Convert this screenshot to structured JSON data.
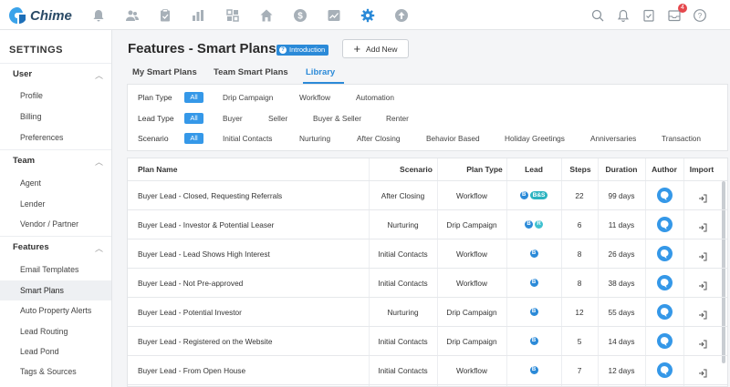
{
  "app": {
    "name": "Chime"
  },
  "topnav": {
    "left_icons": [
      "bell-icon",
      "people-icon",
      "clipboard-icon",
      "bar-chart-icon",
      "dashboard-icon",
      "home-icon",
      "dollar-icon",
      "trend-icon",
      "settings-icon",
      "upload-icon"
    ],
    "right_icons": [
      "search-icon",
      "notification-icon",
      "task-icon",
      "inbox-icon",
      "help-icon"
    ],
    "inbox_badge": "4",
    "accent": "#2b8ad8"
  },
  "sidebar": {
    "title": "SETTINGS",
    "sections": [
      {
        "label": "User",
        "items": [
          "Profile",
          "Billing",
          "Preferences"
        ]
      },
      {
        "label": "Team",
        "items": [
          "Agent",
          "Lender",
          "Vendor / Partner"
        ]
      },
      {
        "label": "Features",
        "items": [
          "Email Templates",
          "Smart Plans",
          "Auto Property Alerts",
          "Lead Routing",
          "Lead Pond",
          "Tags & Sources"
        ]
      }
    ],
    "active_item": "Smart Plans"
  },
  "page": {
    "title": "Features - Smart Plans",
    "intro_label": "Introduction",
    "add_new_label": "Add New",
    "tabs": [
      "My Smart Plans",
      "Team Smart Plans",
      "Library"
    ],
    "active_tab": "Library"
  },
  "filters": {
    "all_label": "All",
    "plan_type": {
      "label": "Plan Type",
      "options": [
        "Drip Campaign",
        "Workflow",
        "Automation"
      ]
    },
    "lead_type": {
      "label": "Lead Type",
      "options": [
        "Buyer",
        "Seller",
        "Buyer & Seller",
        "Renter"
      ]
    },
    "scenario": {
      "label": "Scenario",
      "options": [
        "Initial Contacts",
        "Nurturing",
        "After Closing",
        "Behavior Based",
        "Holiday Greetings",
        "Anniversaries",
        "Transaction"
      ]
    }
  },
  "table": {
    "columns": [
      "Plan Name",
      "Scenario",
      "Plan Type",
      "Lead",
      "Steps",
      "Duration",
      "Author",
      "Import"
    ],
    "rows": [
      {
        "name": "Buyer Lead - Closed, Requesting Referrals",
        "scenario": "After Closing",
        "plan_type": "Workflow",
        "lead": [
          "B",
          "B&S"
        ],
        "steps": "22",
        "duration": "99 days"
      },
      {
        "name": "Buyer Lead - Investor & Potential Leaser",
        "scenario": "Nurturing",
        "plan_type": "Drip Campaign",
        "lead": [
          "B",
          "R"
        ],
        "steps": "6",
        "duration": "11 days"
      },
      {
        "name": "Buyer Lead - Lead Shows High Interest",
        "scenario": "Initial Contacts",
        "plan_type": "Workflow",
        "lead": [
          "B"
        ],
        "steps": "8",
        "duration": "26 days"
      },
      {
        "name": "Buyer Lead - Not Pre-approved",
        "scenario": "Initial Contacts",
        "plan_type": "Workflow",
        "lead": [
          "B"
        ],
        "steps": "8",
        "duration": "38 days"
      },
      {
        "name": "Buyer Lead - Potential Investor",
        "scenario": "Nurturing",
        "plan_type": "Drip Campaign",
        "lead": [
          "B"
        ],
        "steps": "12",
        "duration": "55 days"
      },
      {
        "name": "Buyer Lead - Registered on the Website",
        "scenario": "Initial Contacts",
        "plan_type": "Drip Campaign",
        "lead": [
          "B"
        ],
        "steps": "5",
        "duration": "14 days"
      },
      {
        "name": "Buyer Lead - From Open House",
        "scenario": "Initial Contacts",
        "plan_type": "Workflow",
        "lead": [
          "B"
        ],
        "steps": "7",
        "duration": "12 days"
      }
    ]
  }
}
